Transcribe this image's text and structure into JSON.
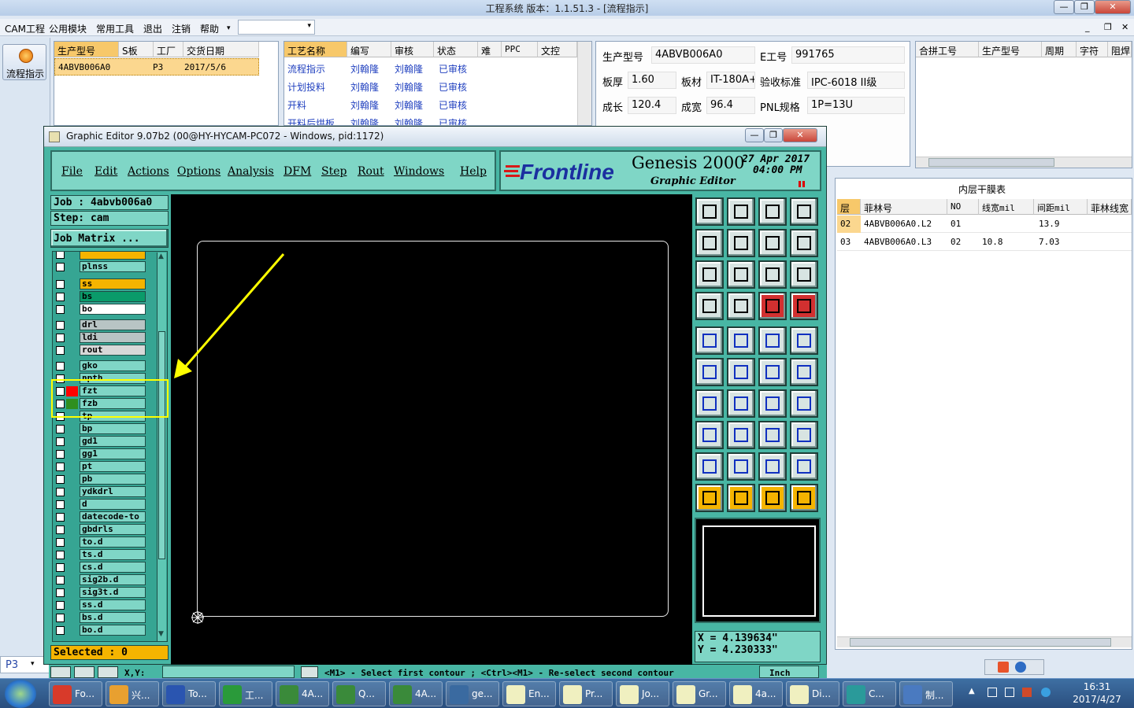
{
  "app": {
    "title": "工程系统    版本：1.1.51.3 - [流程指示]",
    "win_min": "—",
    "win_max": "❐",
    "win_close": "✕",
    "inner_min": "_",
    "inner_max": "❐",
    "inner_close": "✕",
    "menu": [
      "CAM工程",
      "公用模块",
      "常用工具",
      "退出",
      "注销",
      "帮助"
    ],
    "menu_dropdown": "▾",
    "left_button": "流程指示",
    "bottom_left": "P3"
  },
  "order_grid": {
    "headers": [
      "生产型号",
      "S板",
      "工厂",
      "交货日期"
    ],
    "row": [
      "4ABVB006A0",
      "P3",
      "2017/5/6"
    ]
  },
  "process_grid": {
    "headers": [
      "工艺名称",
      "编写",
      "审核",
      "状态",
      "难",
      "PPC",
      "文控"
    ],
    "rows": [
      [
        "流程指示",
        "刘翰隆",
        "刘翰隆",
        "已审核"
      ],
      [
        "计划投料",
        "刘翰隆",
        "刘翰隆",
        "已审核"
      ],
      [
        "开料",
        "刘翰隆",
        "刘翰隆",
        "已审核"
      ],
      [
        "开料后烘板",
        "刘翰隆",
        "刘翰隆",
        "已审核"
      ]
    ]
  },
  "info": {
    "model_label": "生产型号",
    "model_value": "4ABVB006A0",
    "eno_label": "E工号",
    "eno_value": "991765",
    "thick_label": "板厚",
    "thick_value": "1.60",
    "mat_label": "板材",
    "mat_value": "IT-180A+",
    "std_label": "验收标准",
    "std_value": "IPC-6018 II级",
    "len_label": "成长",
    "len_value": "120.4",
    "wid_label": "成宽",
    "wid_value": "96.4",
    "pnl_label": "PNL规格",
    "pnl_value": "1P=13U"
  },
  "merge_grid": {
    "headers": [
      "合拼工号",
      "生产型号",
      "周期",
      "字符",
      "阻焊"
    ]
  },
  "film_table": {
    "title": "内层干膜表",
    "headers": [
      "层",
      "菲林号",
      "NO",
      "线宽mil",
      "间距mil",
      "菲林线宽"
    ],
    "rows": [
      [
        "02",
        "4ABVB006A0.L2",
        "01",
        "",
        "13.9"
      ],
      [
        "03",
        "4ABVB006A0.L3",
        "02",
        "10.8",
        "7.03"
      ]
    ]
  },
  "genesis": {
    "title": "Graphic Editor 9.07b2 (00@HY-HYCAM-PC072 - Windows, pid:1172)",
    "menu": [
      "File",
      "Edit",
      "Actions",
      "Options",
      "Analysis",
      "DFM",
      "Step",
      "Rout",
      "Windows",
      "Help"
    ],
    "logo_frontline": "Frontline",
    "logo_genesis": "Genesis 2000",
    "logo_sub": "Graphic Editor",
    "date": "27  Apr  2017",
    "time": "04:00  PM",
    "job_label": "Job  :  4abvb006a0",
    "step_label": "Step: cam",
    "matrix_button": "Job Matrix ...",
    "selected": "Selected : 0",
    "coord_x": "X  =  4.139634\"",
    "coord_y": "Y  =  4.230333\"",
    "status_text": "<M1> - Select first contour ; <Ctrl><M1> - Re-select second contour",
    "units": "Inch",
    "xy_label": "X,Y:",
    "layers": [
      {
        "name": "",
        "color": "#f5b400"
      },
      {
        "name": "plnss",
        "color": ""
      },
      {
        "name": "ss",
        "color": "#f5b400"
      },
      {
        "name": "bs",
        "color": "#0a9b6a"
      },
      {
        "name": "bo",
        "color": "#ffffff"
      },
      {
        "name": "drl",
        "color": "#b8c4c4"
      },
      {
        "name": "ldi",
        "color": "#b8c4c4"
      },
      {
        "name": "rout",
        "color": "#d8d8d8"
      },
      {
        "name": "gko",
        "color": ""
      },
      {
        "name": "npth",
        "color": ""
      },
      {
        "name": "fzt",
        "color": "#ff0000"
      },
      {
        "name": "fzb",
        "color": "#2f8f1f"
      },
      {
        "name": "tp",
        "color": ""
      },
      {
        "name": "bp",
        "color": ""
      },
      {
        "name": "gd1",
        "color": ""
      },
      {
        "name": "gg1",
        "color": ""
      },
      {
        "name": "pt",
        "color": ""
      },
      {
        "name": "pb",
        "color": ""
      },
      {
        "name": "ydkdrl",
        "color": ""
      },
      {
        "name": "d",
        "color": ""
      },
      {
        "name": "datecode-to",
        "color": ""
      },
      {
        "name": "gbdrls",
        "color": ""
      },
      {
        "name": "to.d",
        "color": ""
      },
      {
        "name": "ts.d",
        "color": ""
      },
      {
        "name": "cs.d",
        "color": ""
      },
      {
        "name": "sig2b.d",
        "color": ""
      },
      {
        "name": "sig3t.d",
        "color": ""
      },
      {
        "name": "ss.d",
        "color": ""
      },
      {
        "name": "bs.d",
        "color": ""
      },
      {
        "name": "bo.d",
        "color": ""
      }
    ]
  },
  "taskbar": {
    "items": [
      "Fo...",
      "兴...",
      "To...",
      "工...",
      "4A...",
      "Q...",
      "4A...",
      "ge...",
      "En...",
      "Pr...",
      "Jo...",
      "Gr...",
      "4a...",
      "Di...",
      "C...",
      "制..."
    ],
    "time": "16:31",
    "date": "2017/4/27"
  },
  "colors": {
    "accent": "#f7c86a",
    "teal": "#48b6a4",
    "annotation": "#ffff00"
  }
}
